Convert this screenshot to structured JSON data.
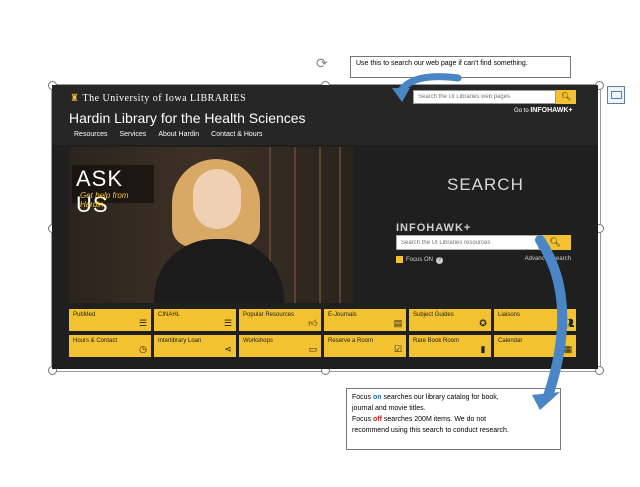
{
  "header": {
    "logo_text": "The University of Iowa LIBRARIES",
    "title": "Hardin Library for the Health Sciences",
    "nav": [
      "Resources",
      "Services",
      "About Hardin",
      "Contact & Hours"
    ],
    "top_search_placeholder": "Search the UI Libraries web pages",
    "goto_label": "Go to",
    "goto_target": "INFOHAWK+"
  },
  "hero": {
    "ask_title": "ASK US",
    "ask_sub": "Get help from Hardin"
  },
  "search": {
    "title": "SEARCH",
    "brand": "INFOHAWK+",
    "placeholder": "Search the UI Libraries resources",
    "focus_label": "Focus ON",
    "advanced_label": "Advanced search"
  },
  "tiles": [
    {
      "label": "PubMed",
      "icon": "database-icon"
    },
    {
      "label": "CINAHL",
      "icon": "database-icon"
    },
    {
      "label": "Popular Resources",
      "icon": "thumbs-up-icon"
    },
    {
      "label": "E-Journals",
      "icon": "document-icon"
    },
    {
      "label": "Subject Guides",
      "icon": "compass-icon"
    },
    {
      "label": "Liaisons",
      "icon": "people-icon"
    },
    {
      "label": "Hours & Contact",
      "icon": "clock-icon"
    },
    {
      "label": "Interlibrary Loan",
      "icon": "share-icon"
    },
    {
      "label": "Workshops",
      "icon": "presentation-icon"
    },
    {
      "label": "Reserve a Room",
      "icon": "calendar-check-icon"
    },
    {
      "label": "Rare Book Room",
      "icon": "book-icon"
    },
    {
      "label": "Calendar",
      "icon": "calendar-icon"
    }
  ],
  "callouts": {
    "top": "Use this to search our web page if can't find something.",
    "bottom_line1_pre": "Focus ",
    "bottom_on": "on",
    "bottom_line1_post": " searches our library catalog for book,",
    "bottom_line2": "journal and movie titles.",
    "bottom_line3_pre": "Focus ",
    "bottom_off": "off",
    "bottom_line3_post": " searches 200M items.  We do not",
    "bottom_line4": "recommend using this search to conduct research."
  },
  "colors": {
    "accent": "#f2c230",
    "dark_bg": "#1f1f1f",
    "arrow": "#4a86c5"
  }
}
